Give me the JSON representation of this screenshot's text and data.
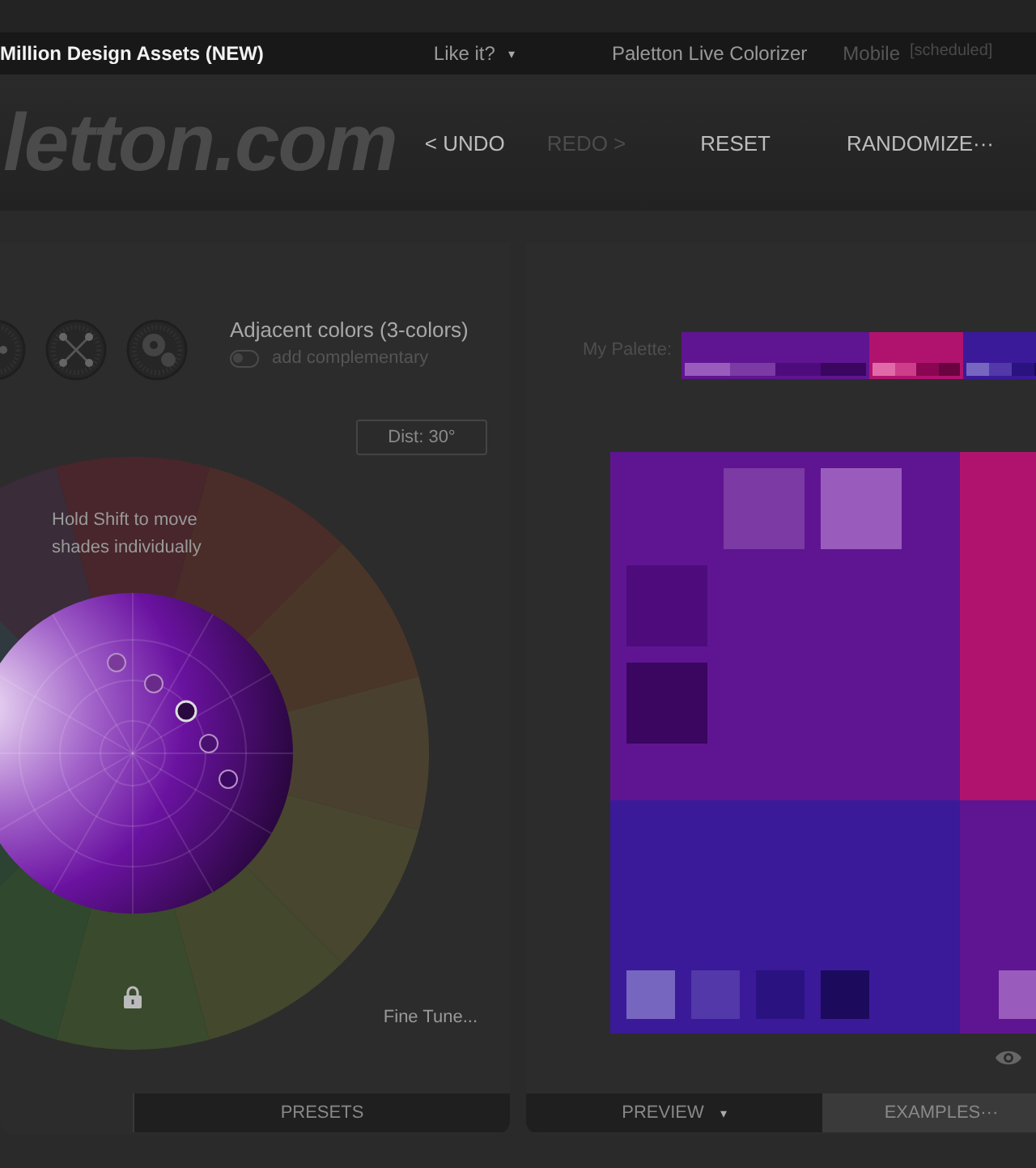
{
  "nav": [
    {
      "label": "Million Design Assets (NEW)",
      "kind": "highlight"
    },
    {
      "label": "Like it?",
      "kind": "dropdown",
      "caret": "▾"
    },
    {
      "label": "Paletton Live Colorizer",
      "kind": "plain"
    },
    {
      "label": "Mobile",
      "kind": "dim",
      "note": "[scheduled]"
    }
  ],
  "logo": "letton.com",
  "actions": [
    {
      "label": "< UNDO",
      "disabled": false
    },
    {
      "label": "REDO >",
      "disabled": true
    },
    {
      "label": "RESET",
      "disabled": false
    },
    {
      "label": "RANDOMIZE···",
      "disabled": false
    }
  ],
  "scheme": {
    "title": "Adjacent colors (3-colors)",
    "toggle": {
      "label": "add complementary",
      "on": false
    },
    "distance": "Dist: 30°"
  },
  "wheel": {
    "hint": "Hold Shift to move shades individually",
    "fine_tune": "Fine Tune..."
  },
  "left_tabs": [
    {
      "label": "PRESETS",
      "selected": false
    }
  ],
  "palette_label": "My Palette:",
  "palette": [
    {
      "color": "#5f1591",
      "shades": [
        {
          "color": "#9a5cbc"
        },
        {
          "color": "#7b3aa4"
        },
        {
          "color": "#4d0b7b"
        },
        {
          "color": "#3a0660"
        }
      ]
    },
    {
      "color": "#b0136e",
      "shades": [
        {
          "color": "#e06aa8"
        },
        {
          "color": "#cc3d8a"
        },
        {
          "color": "#8a0652"
        },
        {
          "color": "#6a0440"
        }
      ]
    },
    {
      "color": "#3a1a99",
      "shades": [
        {
          "color": "#7766c0"
        },
        {
          "color": "#5238a8"
        },
        {
          "color": "#2a1280"
        },
        {
          "color": "#1c0a5c"
        }
      ]
    }
  ],
  "right_tabs": [
    {
      "label": "PREVIEW",
      "caret": "▾",
      "selected": false
    },
    {
      "label": "EXAMPLES···",
      "selected": true
    }
  ]
}
